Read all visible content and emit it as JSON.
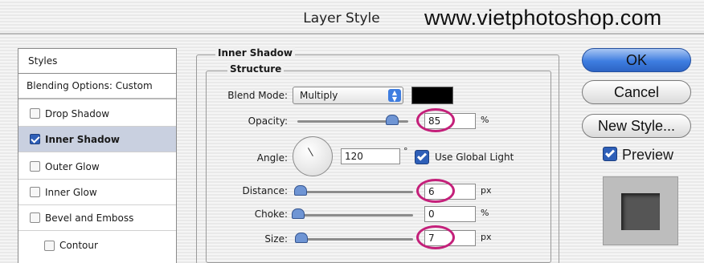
{
  "window": {
    "title": "Layer Style",
    "watermark": "www.vietphotoshop.com"
  },
  "styles_panel": {
    "header": "Styles",
    "items": [
      {
        "label": "Blending Options: Custom",
        "checkbox": false,
        "checked": false,
        "selected": false
      },
      {
        "label": "Drop Shadow",
        "checkbox": true,
        "checked": false,
        "selected": false
      },
      {
        "label": "Inner Shadow",
        "checkbox": true,
        "checked": true,
        "selected": true
      },
      {
        "label": "Outer Glow",
        "checkbox": true,
        "checked": false,
        "selected": false
      },
      {
        "label": "Inner Glow",
        "checkbox": true,
        "checked": false,
        "selected": false
      },
      {
        "label": "Bevel and Emboss",
        "checkbox": true,
        "checked": false,
        "selected": false
      },
      {
        "label": "Contour",
        "checkbox": true,
        "checked": false,
        "selected": false
      }
    ]
  },
  "inner_shadow": {
    "group_title": "Inner Shadow",
    "structure_title": "Structure",
    "blend_mode": {
      "label": "Blend Mode:",
      "value": "Multiply",
      "color": "#000000"
    },
    "opacity": {
      "label": "Opacity:",
      "value": "85",
      "unit": "%",
      "level": 0.85
    },
    "angle": {
      "label": "Angle:",
      "value": "120",
      "unit": "°",
      "use_global_light_label": "Use Global Light",
      "use_global_light": true
    },
    "distance": {
      "label": "Distance:",
      "value": "6",
      "unit": "px",
      "level": 0.02
    },
    "choke": {
      "label": "Choke:",
      "value": "0",
      "unit": "%",
      "level": 0.0
    },
    "size": {
      "label": "Size:",
      "value": "7",
      "unit": "px",
      "level": 0.03
    }
  },
  "buttons": {
    "ok": "OK",
    "cancel": "Cancel",
    "new_style": "New Style...",
    "preview_label": "Preview",
    "preview_checked": true
  },
  "colors": {
    "accent": "#3e7de0",
    "highlight_ring": "#c4207a",
    "selection": "#c9d0e0"
  }
}
